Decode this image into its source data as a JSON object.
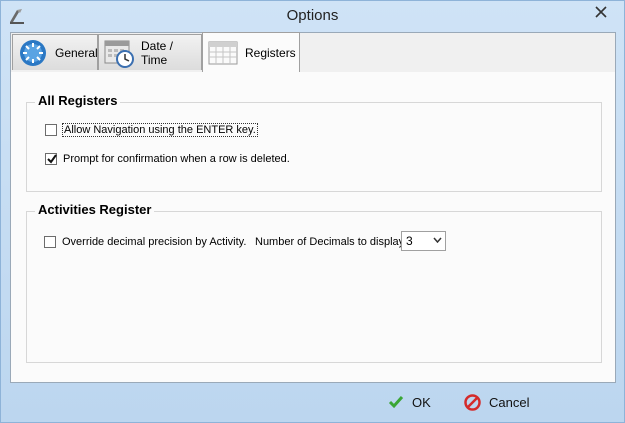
{
  "window": {
    "title": "Options"
  },
  "tabs": [
    {
      "label": "General",
      "icon": "general-icon"
    },
    {
      "label": "Date / Time",
      "icon": "calendar-clock-icon"
    },
    {
      "label": "Registers",
      "icon": "register-grid-icon",
      "active": true
    }
  ],
  "all_registers": {
    "title": "All Registers",
    "allow_navigation": {
      "label": "Allow Navigation using the ENTER key.",
      "checked": false
    },
    "prompt_confirmation": {
      "label": "Prompt for confirmation when a row is deleted.",
      "checked": true
    }
  },
  "activities_register": {
    "title": "Activities Register",
    "override_precision": {
      "label": "Override decimal precision by Activity.",
      "checked": false
    },
    "decimals_label": "Number of Decimals to display",
    "decimals_value": "3"
  },
  "footer": {
    "ok_label": "OK",
    "cancel_label": "Cancel"
  },
  "colors": {
    "title_bar": "#cde2f5",
    "ok_check": "#3aa635",
    "cancel_red": "#d42b2b"
  }
}
